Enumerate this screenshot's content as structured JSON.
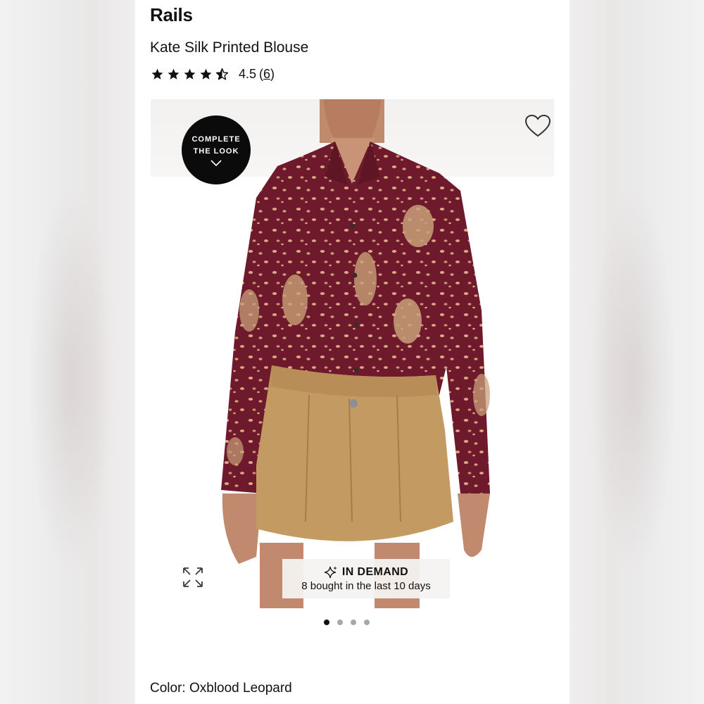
{
  "brand": "Rails",
  "product": {
    "name": "Kate Silk Printed Blouse",
    "rating_value": "4.5",
    "rating_count": "6",
    "stars": 4.5
  },
  "overlay": {
    "complete_look_line1": "COMPLETE",
    "complete_look_line2": "THE LOOK"
  },
  "badge": {
    "title": "IN DEMAND",
    "subtitle": "8 bought in the last 10 days"
  },
  "carousel": {
    "total_images": 4,
    "active_index": 0
  },
  "color": {
    "label": "Color:",
    "value": "Oxblood Leopard"
  },
  "colors": {
    "blouse": "#6e1a2c",
    "skirt": "#c49a63",
    "skin": "#c99377",
    "accent_dark": "#0b0b0b"
  },
  "icons": {
    "rating": "star-icon",
    "favorite": "heart-icon",
    "expand": "expand-icon",
    "demand": "sparkle-icon",
    "dropdown": "chevron-down-icon"
  }
}
